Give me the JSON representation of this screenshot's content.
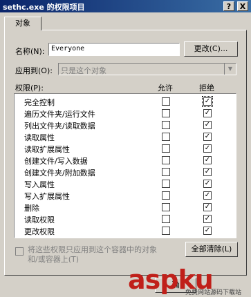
{
  "window": {
    "title": "sethc.exe 的权限项目",
    "help_label": "?",
    "close_label": "X"
  },
  "tab": {
    "label": "对象"
  },
  "name_row": {
    "label": "名称(N):",
    "value": "Everyone",
    "change_button": "更改(C)..."
  },
  "apply_to": {
    "label": "应用到(O):",
    "value": "只是这个对象"
  },
  "permissions": {
    "header_label": "权限(P):",
    "allow_header": "允许",
    "deny_header": "拒绝",
    "rows": [
      {
        "name": "完全控制",
        "allow": false,
        "deny": true
      },
      {
        "name": "遍历文件夹/运行文件",
        "allow": false,
        "deny": true
      },
      {
        "name": "列出文件夹/读取数据",
        "allow": false,
        "deny": true
      },
      {
        "name": "读取属性",
        "allow": false,
        "deny": true
      },
      {
        "name": "读取扩展属性",
        "allow": false,
        "deny": true
      },
      {
        "name": "创建文件/写入数据",
        "allow": false,
        "deny": true
      },
      {
        "name": "创建文件夹/附加数据",
        "allow": false,
        "deny": true
      },
      {
        "name": "写入属性",
        "allow": false,
        "deny": true
      },
      {
        "name": "写入扩展属性",
        "allow": false,
        "deny": true
      },
      {
        "name": "删除",
        "allow": false,
        "deny": true
      },
      {
        "name": "读取权限",
        "allow": false,
        "deny": true
      },
      {
        "name": "更改权限",
        "allow": false,
        "deny": true
      }
    ]
  },
  "apply_checkbox": {
    "label_line1": "将这些权限只应用到这个容器中的对象",
    "label_line2": "和/或容器上(T)"
  },
  "clear_all_button": "全部清除(L)",
  "ok_button_partial": "确",
  "watermark": {
    "main": "aspku",
    "sub": "免费网站源码下载站"
  }
}
